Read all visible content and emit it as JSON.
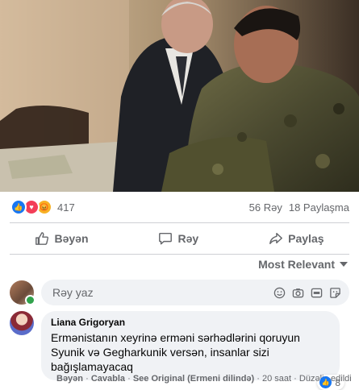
{
  "post": {
    "reaction_count": "417",
    "comments_count": "56 Rəy",
    "shares_count": "18 Paylaşma",
    "reaction_types": [
      "like-icon",
      "love-icon",
      "angry-icon"
    ]
  },
  "actions": {
    "like": "Bəyən",
    "comment": "Rəy",
    "share": "Paylaş"
  },
  "sort": {
    "label": "Most Relevant"
  },
  "composer": {
    "placeholder": "Rəy yaz"
  },
  "comment": {
    "author": "Liana Grigoryan",
    "text": "Ermənistanın xeyrinə erməni sərhədlərini qoruyun Syunik və Gegharkunik versən, insanlar sizi bağışlamayacaq",
    "reaction_count": "8",
    "meta": {
      "like": "Bəyən",
      "reply": "Cavabla",
      "see_original": "See Original (Ermeni dilində)",
      "time": "20 saat",
      "edited": "Düzəliş edildi"
    }
  },
  "colors": {
    "accent": "#1877f2",
    "love": "#f33e58",
    "angry": "#f7b125",
    "muted_text": "#65676b",
    "bubble": "#f0f2f5"
  }
}
